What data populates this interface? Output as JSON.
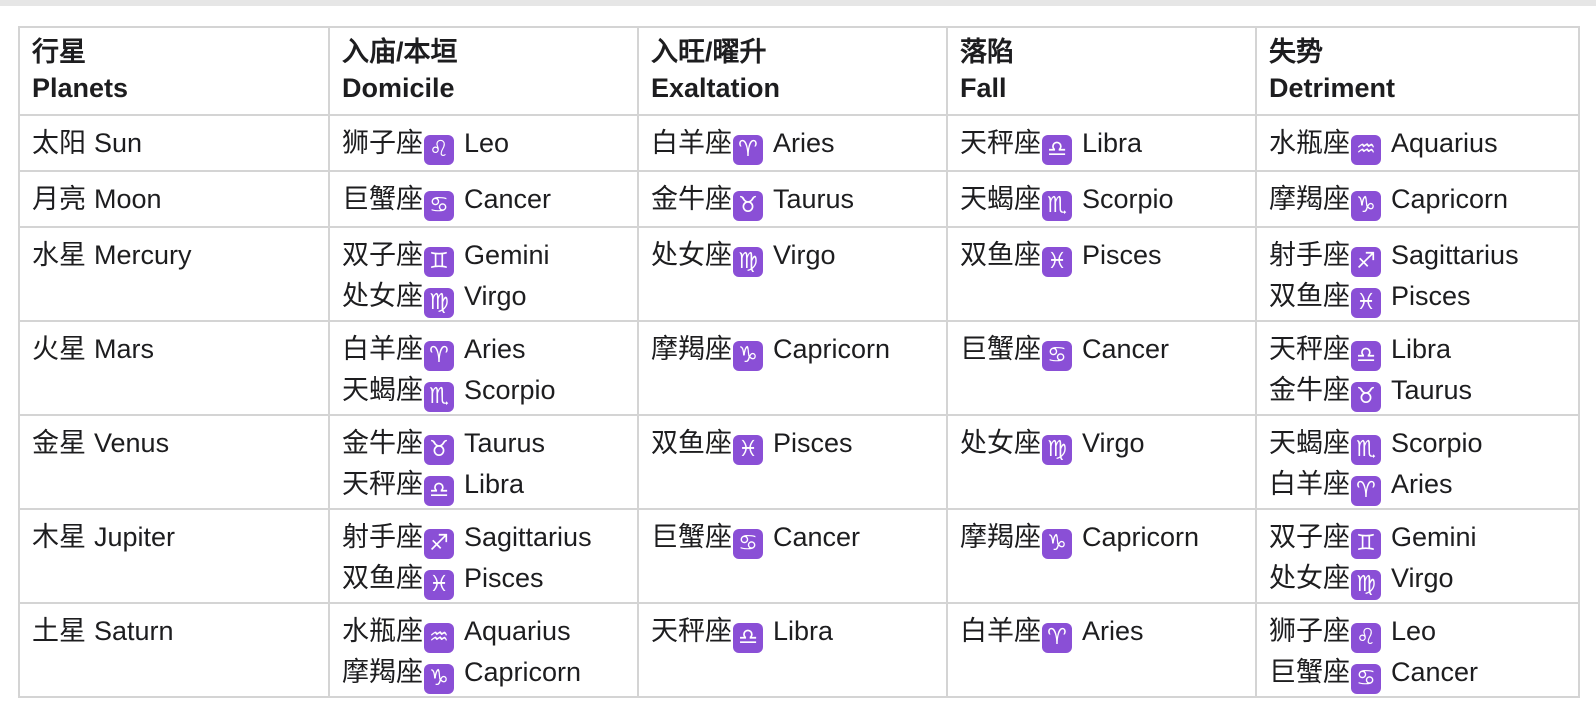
{
  "headers": [
    {
      "zh": "行星",
      "en": "Planets"
    },
    {
      "zh": "入庙/本垣",
      "en": "Domicile"
    },
    {
      "zh": "入旺/曜升",
      "en": "Exaltation"
    },
    {
      "zh": "落陷",
      "en": "Fall"
    },
    {
      "zh": "失势",
      "en": "Detriment"
    }
  ],
  "glyph_color": "#8a4fd6",
  "rows": [
    {
      "planet": {
        "zh": "太阳",
        "en": "Sun"
      },
      "domicile": [
        {
          "zh": "狮子座",
          "glyph": "♌",
          "en": "Leo"
        }
      ],
      "exaltation": [
        {
          "zh": "白羊座",
          "glyph": "♈",
          "en": "Aries"
        }
      ],
      "fall": [
        {
          "zh": "天秤座",
          "glyph": "♎",
          "en": "Libra"
        }
      ],
      "detriment": [
        {
          "zh": "水瓶座",
          "glyph": "♒",
          "en": "Aquarius"
        }
      ]
    },
    {
      "planet": {
        "zh": "月亮",
        "en": "Moon"
      },
      "domicile": [
        {
          "zh": "巨蟹座",
          "glyph": "♋",
          "en": "Cancer"
        }
      ],
      "exaltation": [
        {
          "zh": "金牛座",
          "glyph": "♉",
          "en": "Taurus"
        }
      ],
      "fall": [
        {
          "zh": "天蝎座",
          "glyph": "♏",
          "en": "Scorpio"
        }
      ],
      "detriment": [
        {
          "zh": "摩羯座",
          "glyph": "♑",
          "en": "Capricorn"
        }
      ]
    },
    {
      "planet": {
        "zh": "水星",
        "en": "Mercury"
      },
      "domicile": [
        {
          "zh": "双子座",
          "glyph": "♊",
          "en": "Gemini"
        },
        {
          "zh": "处女座",
          "glyph": "♍",
          "en": "Virgo"
        }
      ],
      "exaltation": [
        {
          "zh": "处女座",
          "glyph": "♍",
          "en": "Virgo"
        }
      ],
      "fall": [
        {
          "zh": "双鱼座",
          "glyph": "♓",
          "en": "Pisces"
        }
      ],
      "detriment": [
        {
          "zh": "射手座",
          "glyph": "♐",
          "en": "Sagittarius"
        },
        {
          "zh": "双鱼座",
          "glyph": "♓",
          "en": "Pisces"
        }
      ]
    },
    {
      "planet": {
        "zh": "火星",
        "en": "Mars"
      },
      "domicile": [
        {
          "zh": "白羊座",
          "glyph": "♈",
          "en": "Aries"
        },
        {
          "zh": "天蝎座",
          "glyph": "♏",
          "en": "Scorpio"
        }
      ],
      "exaltation": [
        {
          "zh": "摩羯座",
          "glyph": "♑",
          "en": "Capricorn"
        }
      ],
      "fall": [
        {
          "zh": "巨蟹座",
          "glyph": "♋",
          "en": "Cancer"
        }
      ],
      "detriment": [
        {
          "zh": "天秤座",
          "glyph": "♎",
          "en": "Libra"
        },
        {
          "zh": "金牛座",
          "glyph": "♉",
          "en": "Taurus"
        }
      ]
    },
    {
      "planet": {
        "zh": "金星",
        "en": "Venus"
      },
      "domicile": [
        {
          "zh": "金牛座",
          "glyph": "♉",
          "en": "Taurus"
        },
        {
          "zh": "天秤座",
          "glyph": "♎",
          "en": "Libra"
        }
      ],
      "exaltation": [
        {
          "zh": "双鱼座",
          "glyph": "♓",
          "en": "Pisces"
        }
      ],
      "fall": [
        {
          "zh": "处女座",
          "glyph": "♍",
          "en": "Virgo"
        }
      ],
      "detriment": [
        {
          "zh": "天蝎座",
          "glyph": "♏",
          "en": "Scorpio"
        },
        {
          "zh": "白羊座",
          "glyph": "♈",
          "en": "Aries"
        }
      ]
    },
    {
      "planet": {
        "zh": "木星",
        "en": "Jupiter"
      },
      "domicile": [
        {
          "zh": "射手座",
          "glyph": "♐",
          "en": "Sagittarius"
        },
        {
          "zh": "双鱼座",
          "glyph": "♓",
          "en": "Pisces"
        }
      ],
      "exaltation": [
        {
          "zh": "巨蟹座",
          "glyph": "♋",
          "en": "Cancer"
        }
      ],
      "fall": [
        {
          "zh": "摩羯座",
          "glyph": "♑",
          "en": "Capricorn"
        }
      ],
      "detriment": [
        {
          "zh": "双子座",
          "glyph": "♊",
          "en": "Gemini"
        },
        {
          "zh": "处女座",
          "glyph": "♍",
          "en": "Virgo"
        }
      ]
    },
    {
      "planet": {
        "zh": "土星",
        "en": "Saturn"
      },
      "domicile": [
        {
          "zh": "水瓶座",
          "glyph": "♒",
          "en": "Aquarius"
        },
        {
          "zh": "摩羯座",
          "glyph": "♑",
          "en": "Capricorn"
        }
      ],
      "exaltation": [
        {
          "zh": "天秤座",
          "glyph": "♎",
          "en": "Libra"
        }
      ],
      "fall": [
        {
          "zh": "白羊座",
          "glyph": "♈",
          "en": "Aries"
        }
      ],
      "detriment": [
        {
          "zh": "狮子座",
          "glyph": "♌",
          "en": "Leo"
        },
        {
          "zh": "巨蟹座",
          "glyph": "♋",
          "en": "Cancer"
        }
      ]
    }
  ]
}
